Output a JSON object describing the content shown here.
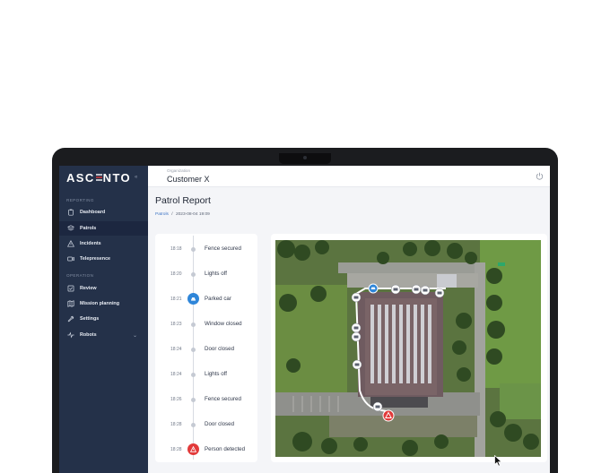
{
  "app": {
    "logo": "ASC NTO"
  },
  "sidebar": {
    "collapse_icon": "double-chevron-left-icon",
    "sections": [
      {
        "label": "REPORTING"
      },
      {
        "label": "OPERATION"
      }
    ],
    "items": [
      {
        "label": "Dashboard",
        "icon": "clipboard-icon"
      },
      {
        "label": "Patrols",
        "icon": "layers-icon",
        "active": true
      },
      {
        "label": "Incidents",
        "icon": "warning-icon"
      },
      {
        "label": "Telepresence",
        "icon": "video-icon"
      },
      {
        "label": "Review",
        "icon": "checkbox-icon"
      },
      {
        "label": "Mission planning",
        "icon": "map-icon"
      },
      {
        "label": "Settings",
        "icon": "wrench-icon"
      },
      {
        "label": "Robots",
        "icon": "activity-icon",
        "expand": "⌄"
      }
    ]
  },
  "topbar": {
    "org_label": "Organization",
    "org_name": "Customer X",
    "power_icon": "power-icon"
  },
  "page": {
    "title": "Patrol Report"
  },
  "breadcrumb": {
    "root": "Patrols",
    "sep": "/",
    "current": "2023-08-04 19:09"
  },
  "timeline": [
    {
      "time": "18:18",
      "event": "Fence secured"
    },
    {
      "time": "18:20",
      "event": "Lights off"
    },
    {
      "time": "18:21",
      "event": "Parked car",
      "marker": "blue-car-icon"
    },
    {
      "time": "18:23",
      "event": "Window closed"
    },
    {
      "time": "18:24",
      "event": "Door closed"
    },
    {
      "time": "18:24",
      "event": "Lights off"
    },
    {
      "time": "18:26",
      "event": "Fence secured"
    },
    {
      "time": "18:28",
      "event": "Door closed"
    },
    {
      "time": "18:28",
      "event": "Person detected",
      "marker": "red-warning-icon"
    }
  ],
  "colors": {
    "sidebar": "#243149",
    "accent_blue": "#2f86d9",
    "alert_red": "#e23a3a",
    "roof": "#6f5b60",
    "grass": "#4e7a34"
  }
}
